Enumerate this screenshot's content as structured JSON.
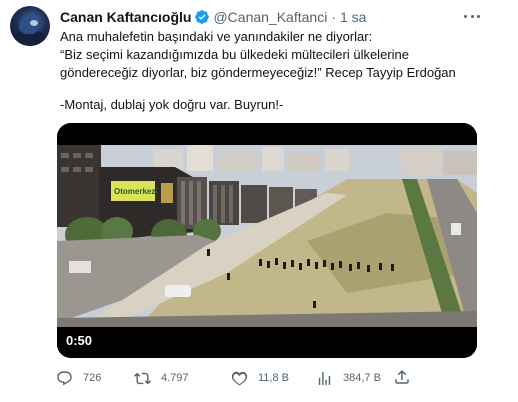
{
  "tweet": {
    "author_name": "Canan Kaftancıoğlu",
    "handle": "@Canan_Kaftanci",
    "separator": "·",
    "time": "1 sa",
    "text_lines": [
      "Ana muhalefetin başındaki ve yanındakiler ne diyorlar:",
      "“Biz seçimi kazandığımızda bu ülkedeki mültecileri ülkelerine",
      "göndereceğiz diyorlar, biz göndermeyeceğiz!” Recep Tayyip Erdoğan",
      "-Montaj, dublaj yok doğru var. Buyrun!-"
    ],
    "video": {
      "duration": "0:50",
      "billboard_text": "Otomerkezi"
    },
    "actions": {
      "replies": "726",
      "retweets": "4.797",
      "likes": "11,8 B",
      "views": "384,7 B"
    }
  },
  "colors": {
    "text_primary": "#0f1419",
    "text_secondary": "#536471",
    "verified_blue": "#1d9bf0"
  },
  "icons": [
    "verified-badge-icon",
    "more-options-icon",
    "reply-icon",
    "retweet-icon",
    "like-icon",
    "views-icon",
    "share-icon"
  ]
}
